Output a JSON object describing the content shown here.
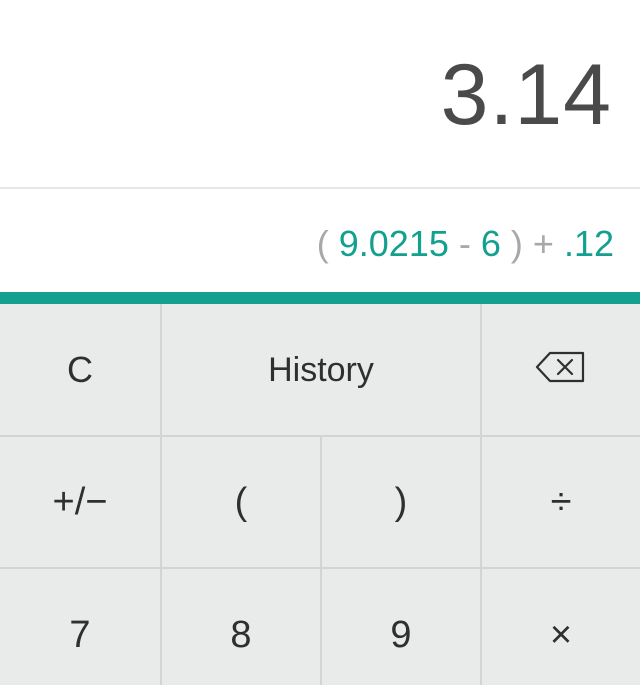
{
  "display": {
    "result": "3.14",
    "expression": {
      "open_paren_1": "(",
      "num_1": "9.0215",
      "op_1": "-",
      "num_2": "6",
      "close_paren_1": ")",
      "op_2": "+",
      "num_3": ".12"
    }
  },
  "keypad": {
    "row1": {
      "clear": "C",
      "history": "History",
      "backspace_icon": "backspace-icon"
    },
    "row2": {
      "plus_minus": "+/−",
      "open_paren": "(",
      "close_paren": ")",
      "divide": "÷"
    },
    "row3": {
      "seven": "7",
      "eight": "8",
      "nine": "9",
      "multiply": "×"
    }
  },
  "colors": {
    "accent": "#13a08e",
    "result_text": "#4a4a4a",
    "expression_muted": "#a8a8a8",
    "keypad_bg": "#e9ebea",
    "key_text": "#2f2f2f"
  }
}
